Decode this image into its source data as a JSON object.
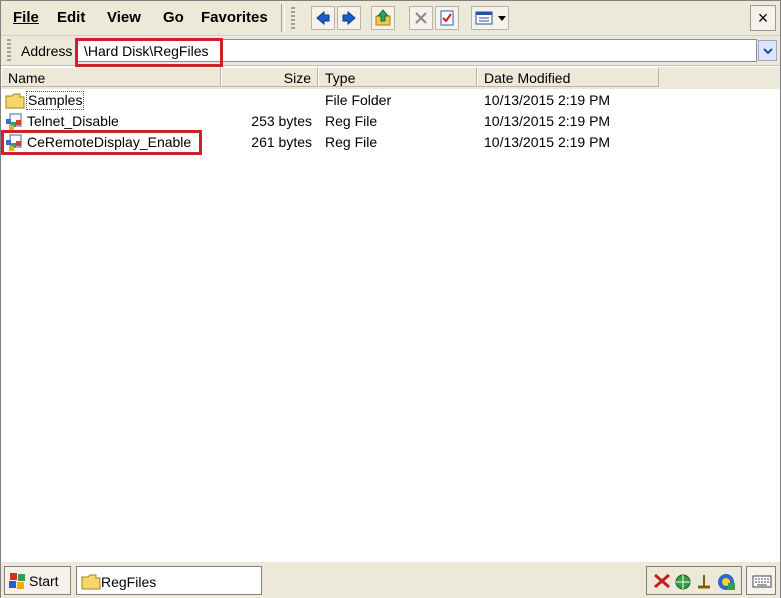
{
  "menu": {
    "file": "File",
    "edit": "Edit",
    "view": "View",
    "go": "Go",
    "favorites": "Favorites"
  },
  "toolbar": {
    "icons": [
      "back-arrow-icon",
      "forward-arrow-icon",
      "up-folder-icon",
      "delete-icon",
      "properties-icon",
      "views-icon"
    ],
    "close_label": "×"
  },
  "address": {
    "label": "Address",
    "value": "\\Hard Disk\\RegFiles"
  },
  "columns": {
    "name": "Name",
    "size": "Size",
    "type": "Type",
    "date": "Date Modified"
  },
  "files": [
    {
      "name": "Samples",
      "size": "",
      "type": "File Folder",
      "date": "10/13/2015 2:19 PM",
      "icon": "folder-icon"
    },
    {
      "name": "Telnet_Disable",
      "size": "253 bytes",
      "type": "Reg File",
      "date": "10/13/2015 2:19 PM",
      "icon": "reg-file-icon"
    },
    {
      "name": "CeRemoteDisplay_Enable",
      "size": "261 bytes",
      "type": "Reg File",
      "date": "10/13/2015 2:19 PM",
      "icon": "reg-file-icon"
    }
  ],
  "taskbar": {
    "start_label": "Start",
    "window_label": "RegFiles"
  },
  "colors": {
    "highlight": "#d0202a",
    "chrome": "#ece9d8"
  }
}
